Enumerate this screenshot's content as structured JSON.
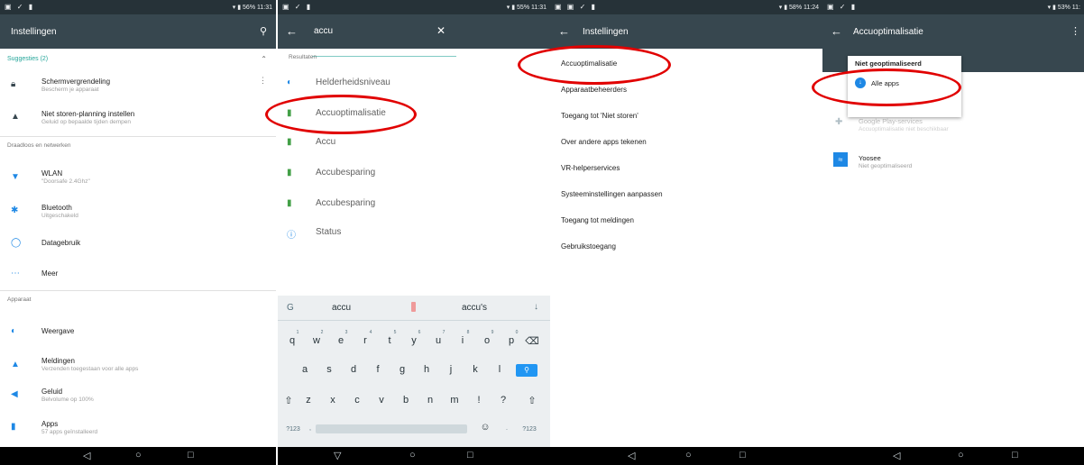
{
  "screen1": {
    "status": {
      "left": "▣ ✓ ▮",
      "right": "▾ ▮ 56% 11:31"
    },
    "title": "Instellingen",
    "search_icon": "search-icon",
    "suggestions_header": "Suggesties (2)",
    "suggestions": [
      {
        "title": "Schermvergrendeling",
        "subtitle": "Bescherm je apparaat"
      },
      {
        "title": "Niet storen-planning instellen",
        "subtitle": "Geluid op bepaalde tijden dempen"
      }
    ],
    "section_wireless": "Draadloos en netwerken",
    "wireless": [
      {
        "title": "WLAN",
        "subtitle": "\"Doorsafe 2.4Ghz\""
      },
      {
        "title": "Bluetooth",
        "subtitle": "Uitgeschakeld"
      },
      {
        "title": "Datagebruik",
        "subtitle": ""
      },
      {
        "title": "Meer",
        "subtitle": ""
      }
    ],
    "section_device": "Apparaat",
    "device": [
      {
        "title": "Weergave",
        "subtitle": ""
      },
      {
        "title": "Meldingen",
        "subtitle": "Verzenden toegestaan voor alle apps"
      },
      {
        "title": "Geluid",
        "subtitle": "Belvolume op 100%"
      },
      {
        "title": "Apps",
        "subtitle": "57 apps geïnstalleerd"
      }
    ]
  },
  "screen2": {
    "status": {
      "left": "▣ ✓ ▮",
      "right": "▾ ▮ 55% 11:31"
    },
    "search_value": "accu",
    "results_header": "Resultaten",
    "results": [
      {
        "label": "Helderheidsniveau"
      },
      {
        "label": "Accuoptimalisatie"
      },
      {
        "label": "Accu"
      },
      {
        "label": "Accubesparing"
      },
      {
        "label": "Accubesparing"
      },
      {
        "label": "Status"
      }
    ],
    "keyboard": {
      "suggestions": [
        "accu",
        "accu's"
      ],
      "row1": [
        "q",
        "w",
        "e",
        "r",
        "t",
        "y",
        "u",
        "i",
        "o",
        "p"
      ],
      "row1_nums": [
        "1",
        "2",
        "3",
        "4",
        "5",
        "6",
        "7",
        "8",
        "9",
        "0"
      ],
      "row2": [
        "a",
        "s",
        "d",
        "f",
        "g",
        "h",
        "j",
        "k",
        "l"
      ],
      "row3": [
        "z",
        "x",
        "c",
        "v",
        "b",
        "n",
        "m",
        "!",
        "?"
      ],
      "sym_left": "?123",
      "sym_right": "?123",
      "comma": ",",
      "period": "."
    }
  },
  "screen3": {
    "status": {
      "left": "▣ ▣ ✓ ▮",
      "right": "▾ ▮ 58% 11:24"
    },
    "title": "Instellingen",
    "items": [
      {
        "label": "Accuoptimalisatie"
      },
      {
        "label": "Apparaatbeheerders"
      },
      {
        "label": "Toegang tot 'Niet storen'"
      },
      {
        "label": "Over andere apps tekenen"
      },
      {
        "label": "VR-helperservices"
      },
      {
        "label": "Systeeminstellingen aanpassen"
      },
      {
        "label": "Toegang tot meldingen"
      },
      {
        "label": "Gebruikstoegang"
      }
    ]
  },
  "screen4": {
    "status": {
      "left": "▣ ✓ ▮",
      "right": "▾ ▮ 53% 11:"
    },
    "title": "Accuoptimalisatie",
    "spinner_value": "Niet geoptimaliseerd",
    "dropdown_option": "Alle apps",
    "apps": [
      {
        "title": "Google Play-services",
        "subtitle": "Accuoptimalisatie niet beschikbaar"
      },
      {
        "title": "Yoosee",
        "subtitle": "Niet geoptimaliseerd"
      }
    ]
  },
  "colors": {
    "appbar": "#37474f",
    "statusbar": "#263238",
    "accent": "#26a69a",
    "highlight": "#e10000"
  }
}
